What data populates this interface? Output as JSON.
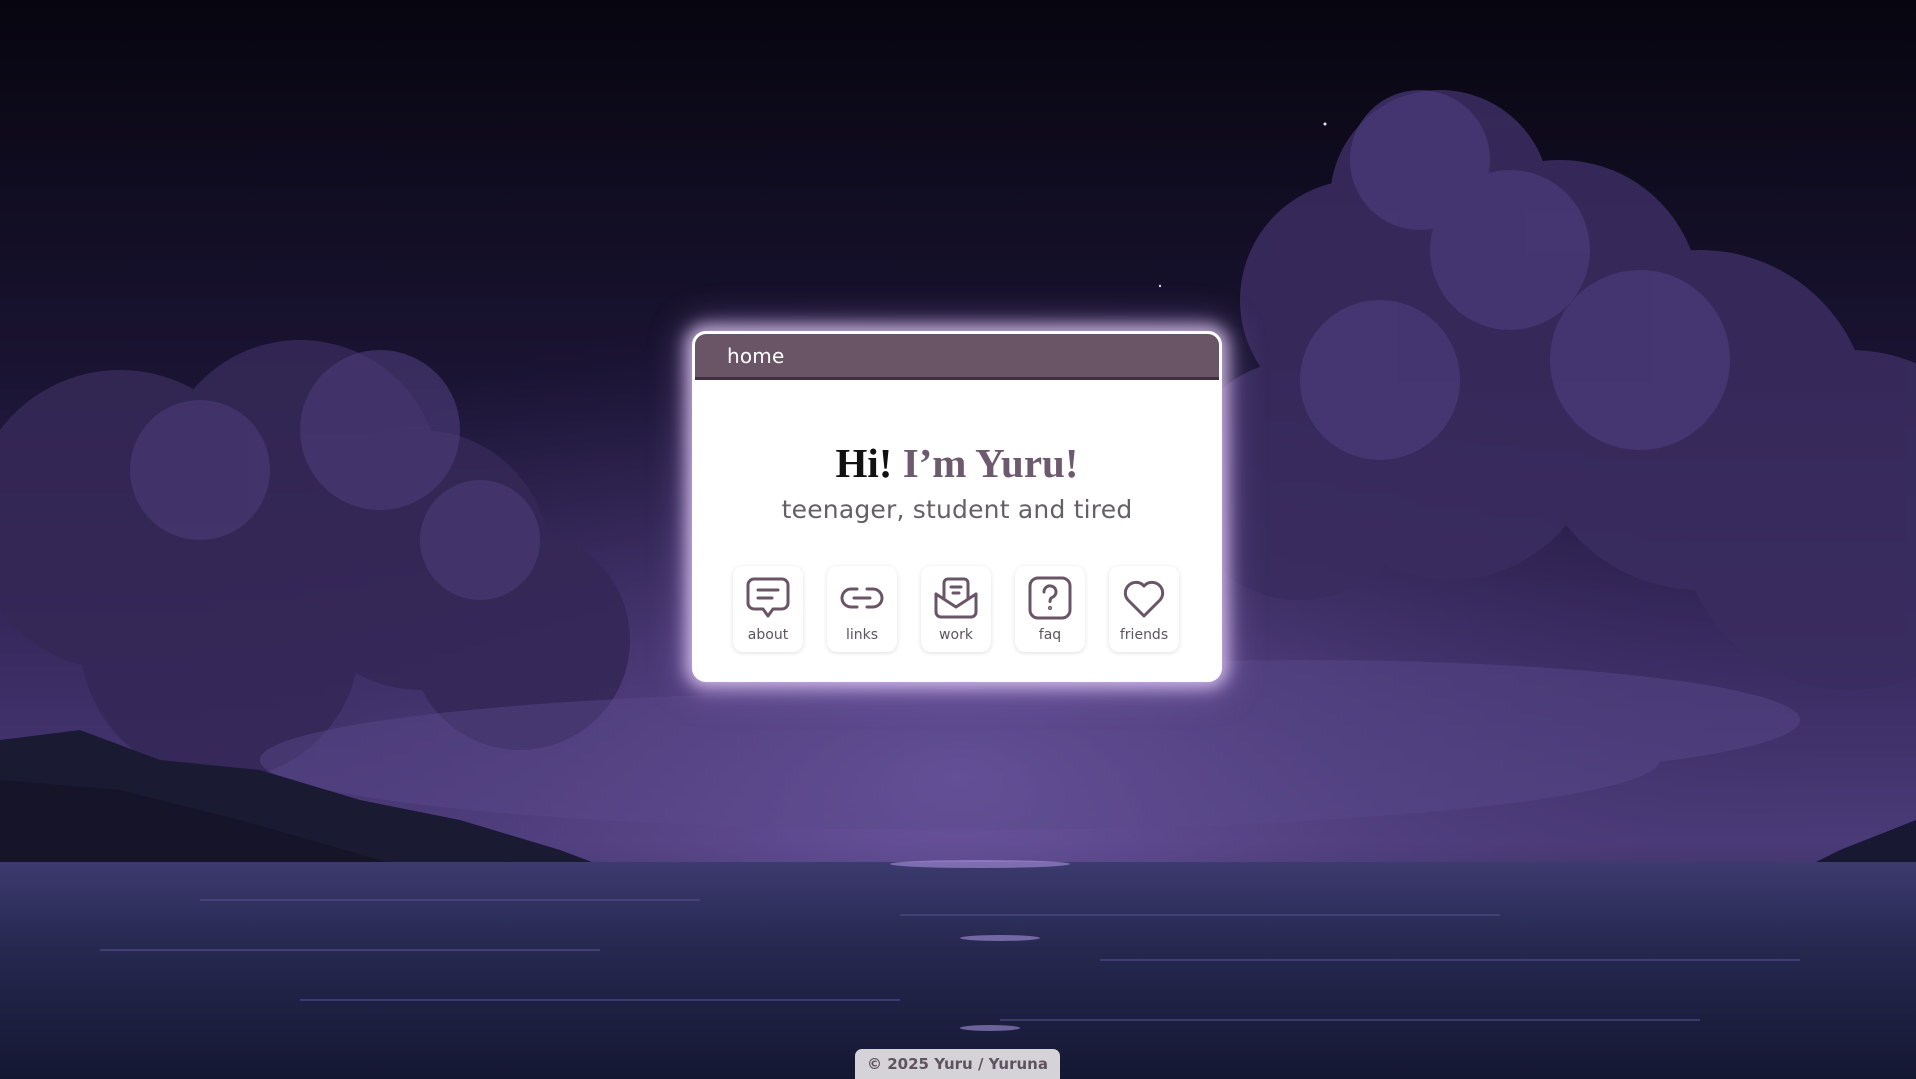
{
  "window": {
    "title": "home"
  },
  "intro": {
    "greeting": "Hi!",
    "name": "I’m Yuru!",
    "tagline": "teenager, student and tired"
  },
  "nav": {
    "items": [
      {
        "label": "about",
        "icon": "chat-bubble-icon"
      },
      {
        "label": "links",
        "icon": "link-icon"
      },
      {
        "label": "work",
        "icon": "envelope-icon"
      },
      {
        "label": "faq",
        "icon": "question-icon"
      },
      {
        "label": "friends",
        "icon": "heart-icon"
      }
    ]
  },
  "footer": {
    "text": "© 2025 Yuru / Yuruna"
  },
  "colors": {
    "titlebar": "#6a5567",
    "accent_name": "#6e5a6e",
    "icon_stroke": "#6a5567",
    "footer_bg": "#d6d3d8"
  }
}
